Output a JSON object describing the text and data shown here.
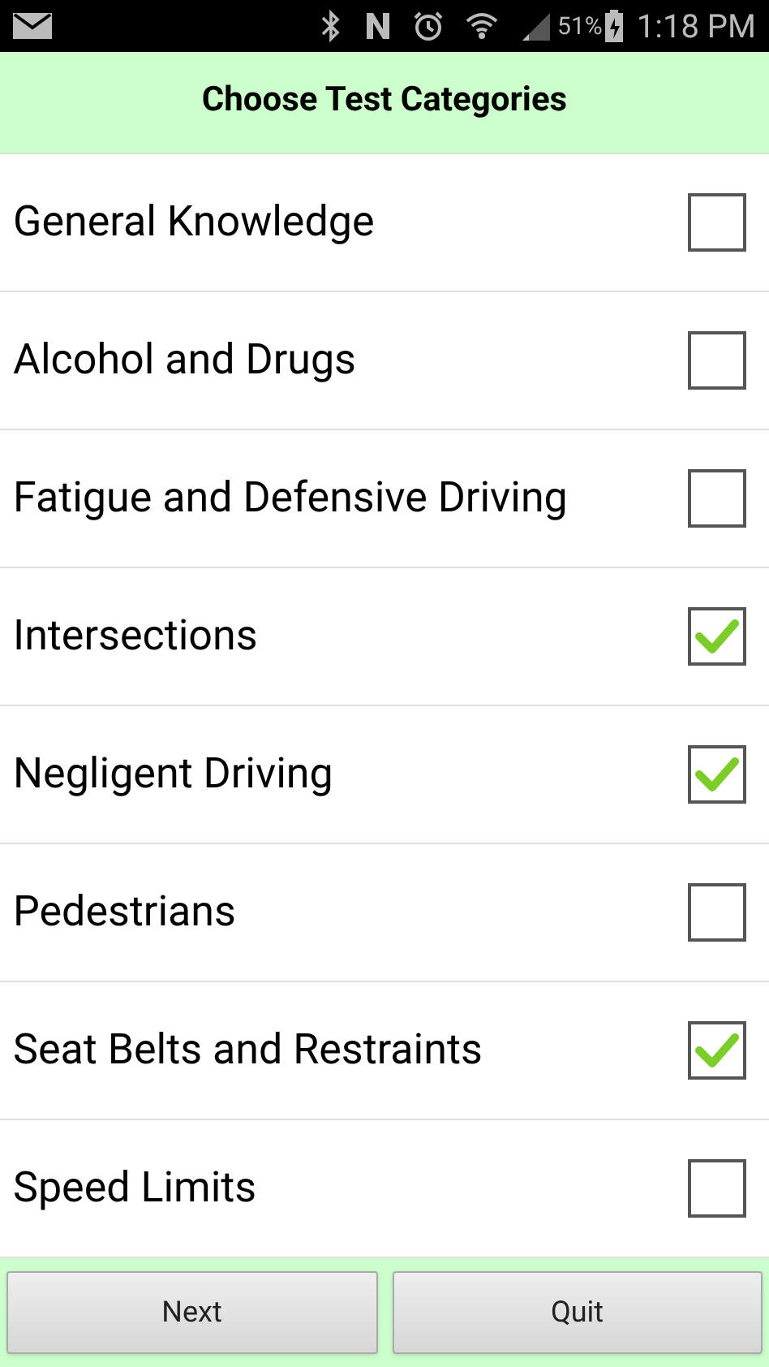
{
  "status_bar": {
    "battery": "51%",
    "time": "1:18 PM"
  },
  "header": {
    "title": "Choose Test Categories"
  },
  "categories": [
    {
      "label": "General Knowledge",
      "checked": false
    },
    {
      "label": "Alcohol and Drugs",
      "checked": false
    },
    {
      "label": "Fatigue and Defensive Driving",
      "checked": false
    },
    {
      "label": "Intersections",
      "checked": true
    },
    {
      "label": "Negligent Driving",
      "checked": true
    },
    {
      "label": "Pedestrians",
      "checked": false
    },
    {
      "label": "Seat Belts and Restraints",
      "checked": true
    },
    {
      "label": "Speed Limits",
      "checked": false
    }
  ],
  "buttons": [
    "Next",
    "Quit"
  ]
}
